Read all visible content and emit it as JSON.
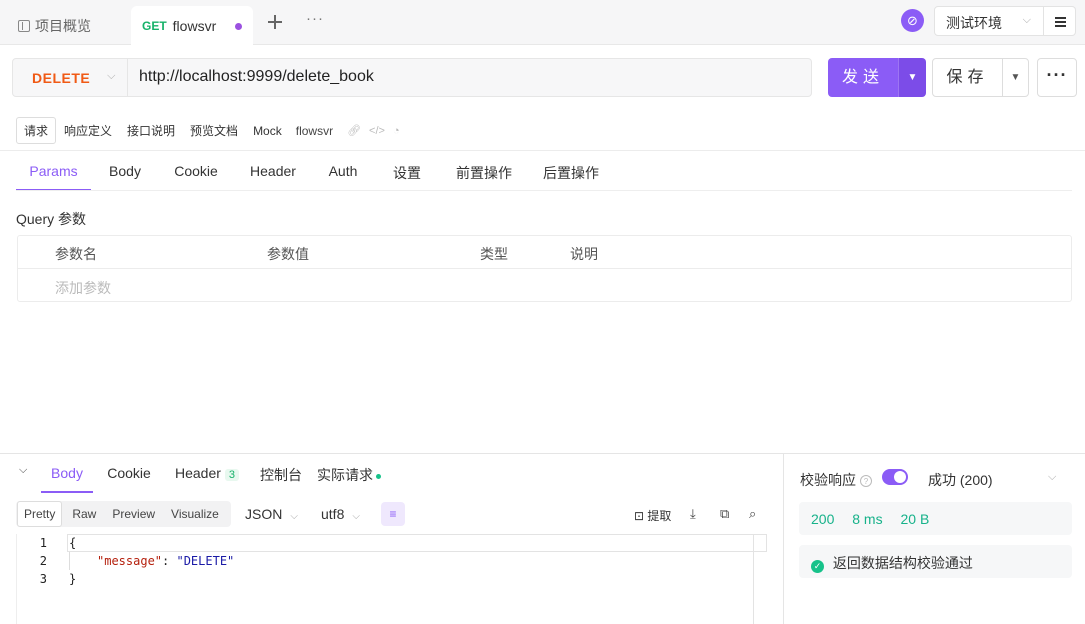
{
  "topbar": {
    "overview_tab": "项目概览",
    "active_tab": {
      "method": "GET",
      "name": "flowsvr"
    },
    "more_glyph": "···",
    "environment": "测试环境"
  },
  "request": {
    "method": "DELETE",
    "url": "http://localhost:9999/delete_book",
    "send_label": "发送",
    "save_label": "保存"
  },
  "subtabs": {
    "items": [
      "请求",
      "响应定义",
      "接口说明",
      "预览文档",
      "Mock"
    ],
    "name": "flowsvr"
  },
  "params_tabs": [
    "Params",
    "Body",
    "Cookie",
    "Header",
    "Auth",
    "设置",
    "前置操作",
    "后置操作"
  ],
  "query": {
    "label": "Query 参数",
    "columns": [
      "参数名",
      "参数值",
      "类型",
      "说明"
    ],
    "add_placeholder": "添加参数"
  },
  "response": {
    "tabs": [
      "Body",
      "Cookie",
      "Header",
      "控制台",
      "实际请求"
    ],
    "header_count": "3",
    "formats": [
      "Pretty",
      "Raw",
      "Preview",
      "Visualize"
    ],
    "type": "JSON",
    "encoding": "utf8",
    "extract_label": "提取",
    "code_lines": [
      {
        "n": "1",
        "text": "{"
      },
      {
        "n": "2",
        "key": "\"message\"",
        "value": "\"DELETE\""
      },
      {
        "n": "3",
        "text": "}"
      }
    ]
  },
  "validation": {
    "label": "校验响应",
    "status": "成功 (200)",
    "code": "200",
    "time": "8 ms",
    "size": "20 B",
    "result": "返回数据结构校验通过"
  },
  "colors": {
    "accent": "#8b5cf6",
    "method_delete": "#f05a15",
    "method_get": "#17b26a",
    "success": "#17b28a"
  }
}
